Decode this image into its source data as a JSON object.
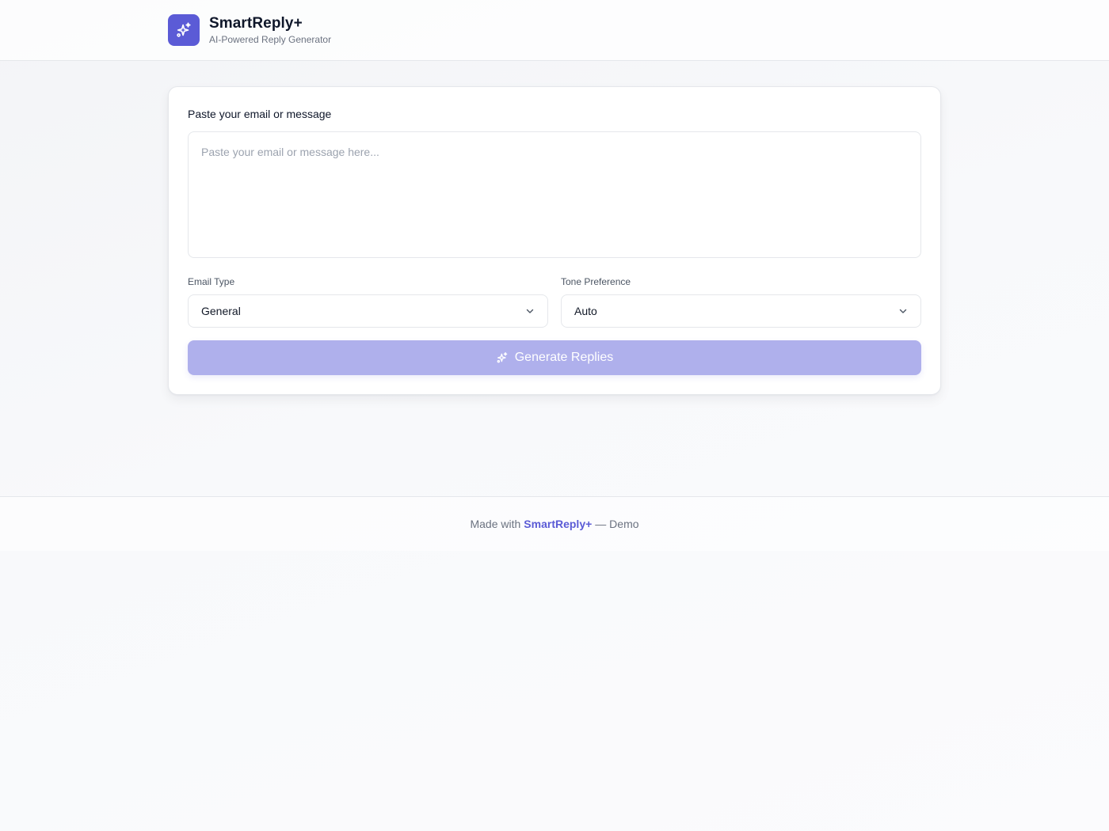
{
  "header": {
    "title": "SmartReply+",
    "subtitle": "AI-Powered Reply Generator",
    "logo_icon": "sparkles-icon"
  },
  "form": {
    "message_label": "Paste your email or message",
    "message_placeholder": "Paste your email or message here...",
    "message_value": "",
    "email_type_label": "Email Type",
    "email_type_value": "General",
    "tone_label": "Tone Preference",
    "tone_value": "Auto",
    "generate_label": "Generate Replies"
  },
  "footer": {
    "prefix": "Made with",
    "brand": "SmartReply+",
    "suffix": "— Demo"
  },
  "colors": {
    "accent": "#5b5bd6",
    "button_disabled": "#afb0ec",
    "border": "#e5e7eb"
  }
}
